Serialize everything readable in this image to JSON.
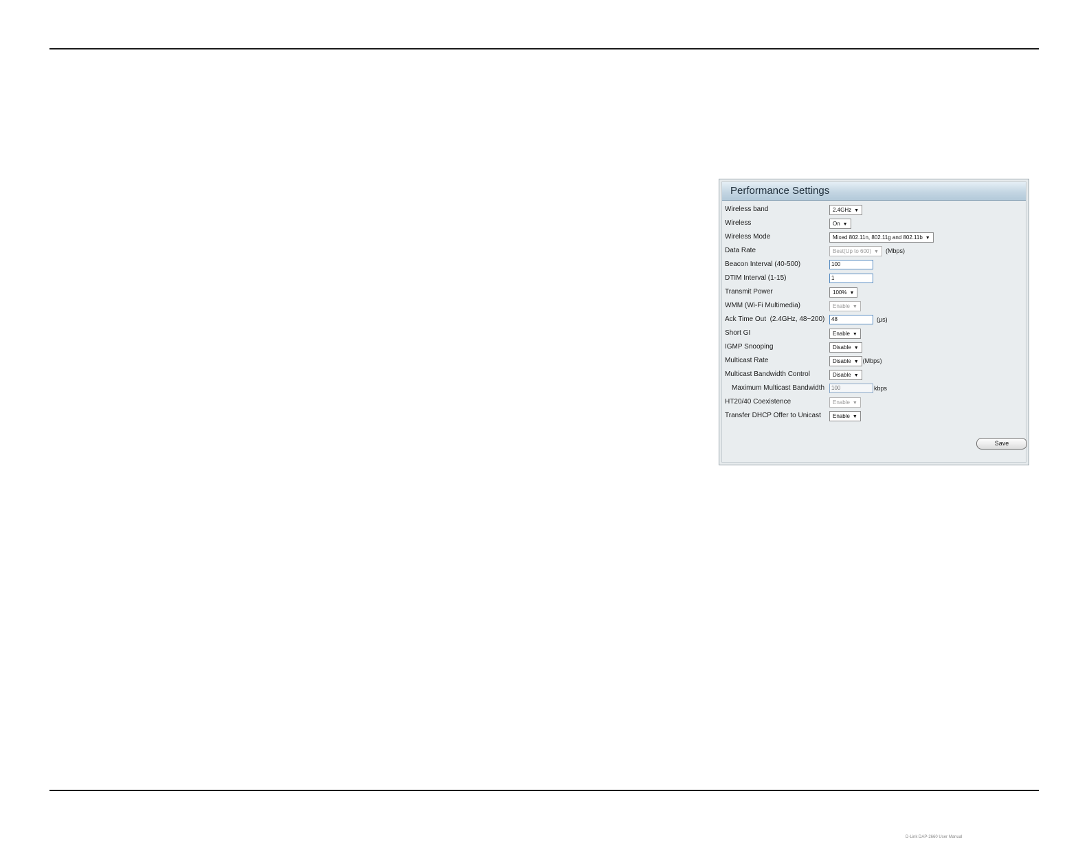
{
  "footer": {
    "text": "D-Link DAP-2660 User Manual"
  },
  "panel": {
    "title": "Performance Settings",
    "rows": [
      {
        "label": "Wireless band",
        "type": "select",
        "value": "2.4GHz"
      },
      {
        "label": "Wireless",
        "type": "select",
        "value": "On"
      },
      {
        "label": "Wireless Mode",
        "type": "select",
        "value": "Mixed 802.11n, 802.11g and 802.11b"
      },
      {
        "label": "Data Rate",
        "type": "select",
        "value": "Best(Up to 600)",
        "disabled": true,
        "unit": "(Mbps)"
      },
      {
        "label": "Beacon Interval (40-500)",
        "type": "input",
        "value": "100"
      },
      {
        "label": "DTIM Interval (1-15)",
        "type": "input",
        "value": "1"
      },
      {
        "label": "Transmit Power",
        "type": "select",
        "value": "100%"
      },
      {
        "label": "WMM (Wi-Fi Multimedia)",
        "type": "select",
        "value": "Enable",
        "disabled": true
      },
      {
        "label": "Ack Time Out  (2.4GHz, 48~200)",
        "type": "input",
        "value": "48",
        "unit": "(μs)"
      },
      {
        "label": "Short GI",
        "type": "select",
        "value": "Enable"
      },
      {
        "label": "IGMP Snooping",
        "type": "select",
        "value": "Disable"
      },
      {
        "label": "Multicast Rate",
        "type": "select",
        "value": "Disable",
        "unit": "(Mbps)"
      },
      {
        "label": "Multicast Bandwidth Control",
        "type": "select",
        "value": "Disable"
      },
      {
        "label": "Maximum Multicast Bandwidth",
        "type": "input",
        "value": "100",
        "disabled": true,
        "unit": "kbps"
      },
      {
        "label": "HT20/40 Coexistence",
        "type": "select",
        "value": "Enable",
        "disabled": true
      },
      {
        "label": "Transfer DHCP Offer to Unicast",
        "type": "select",
        "value": "Enable"
      }
    ],
    "save_label": "Save"
  }
}
